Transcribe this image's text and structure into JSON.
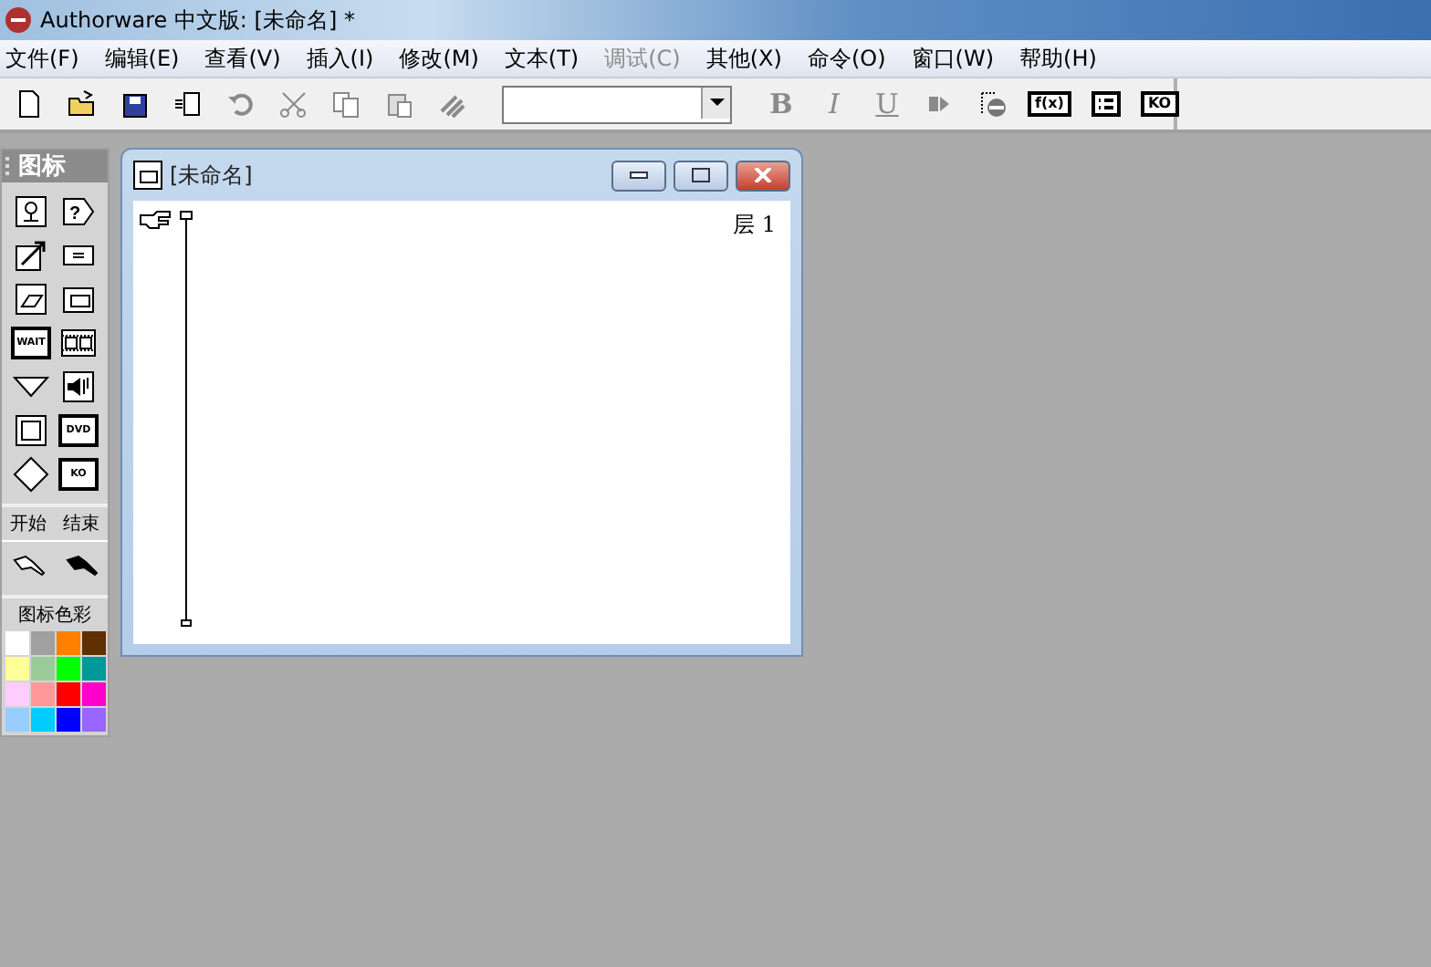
{
  "window": {
    "title": "Authorware 中文版: [未命名] *"
  },
  "menu": [
    {
      "label": "文件(F)",
      "disabled": false
    },
    {
      "label": "编辑(E)",
      "disabled": false
    },
    {
      "label": "查看(V)",
      "disabled": false
    },
    {
      "label": "插入(I)",
      "disabled": false
    },
    {
      "label": "修改(M)",
      "disabled": false
    },
    {
      "label": "文本(T)",
      "disabled": false
    },
    {
      "label": "调试(C)",
      "disabled": true
    },
    {
      "label": "其他(X)",
      "disabled": false
    },
    {
      "label": "命令(O)",
      "disabled": false
    },
    {
      "label": "窗口(W)",
      "disabled": false
    },
    {
      "label": "帮助(H)",
      "disabled": false
    }
  ],
  "toolbar": [
    {
      "kind": "new",
      "disabled": false
    },
    {
      "kind": "open",
      "disabled": false
    },
    {
      "kind": "save",
      "disabled": false
    },
    {
      "kind": "import",
      "disabled": false
    },
    {
      "kind": "undo",
      "disabled": true
    },
    {
      "kind": "cut",
      "disabled": true
    },
    {
      "kind": "copy",
      "disabled": true
    },
    {
      "kind": "paste",
      "disabled": true
    },
    {
      "kind": "find",
      "disabled": true
    },
    {
      "kind": "combo"
    },
    {
      "kind": "letter",
      "label": "B",
      "disabled": true
    },
    {
      "kind": "letter",
      "label": "I",
      "disabled": true
    },
    {
      "kind": "letter",
      "label": "U",
      "disabled": true
    },
    {
      "kind": "run",
      "disabled": true
    },
    {
      "kind": "control",
      "disabled": false
    },
    {
      "kind": "boxed",
      "label": "f(x)",
      "disabled": false
    },
    {
      "kind": "variables",
      "disabled": false
    },
    {
      "kind": "boxed",
      "label": "KO",
      "disabled": false
    }
  ],
  "palette": {
    "title": "图标",
    "icons": [
      {
        "kind": "display"
      },
      {
        "kind": "decision",
        "label": "?"
      },
      {
        "kind": "motion"
      },
      {
        "kind": "calc"
      },
      {
        "kind": "erase"
      },
      {
        "kind": "sound-frame"
      },
      {
        "kind": "text",
        "label": "WAIT"
      },
      {
        "kind": "movie"
      },
      {
        "kind": "navigate"
      },
      {
        "kind": "speaker"
      },
      {
        "kind": "framework"
      },
      {
        "kind": "text",
        "label": "DVD"
      },
      {
        "kind": "diamond"
      },
      {
        "kind": "text",
        "label": "KO"
      }
    ],
    "flags": [
      {
        "label": "开始",
        "kind": "start"
      },
      {
        "label": "结束",
        "kind": "end"
      }
    ],
    "colors_title": "图标色彩",
    "colors": [
      {
        "color": "#ffffff"
      },
      {
        "color": "#a0a0a0"
      },
      {
        "color": "#ff8000"
      },
      {
        "color": "#603000"
      },
      {
        "color": "#ffff99"
      },
      {
        "color": "#99cc99"
      },
      {
        "color": "#00ff00"
      },
      {
        "color": "#009999"
      },
      {
        "color": "#ffccff"
      },
      {
        "color": "#ff9999"
      },
      {
        "color": "#ff0000"
      },
      {
        "color": "#ff00cc"
      },
      {
        "color": "#99ccff"
      },
      {
        "color": "#00ccff"
      },
      {
        "color": "#0000ff"
      },
      {
        "color": "#9966ff"
      }
    ]
  },
  "design_window": {
    "title": "[未命名]",
    "level": "层 1"
  }
}
